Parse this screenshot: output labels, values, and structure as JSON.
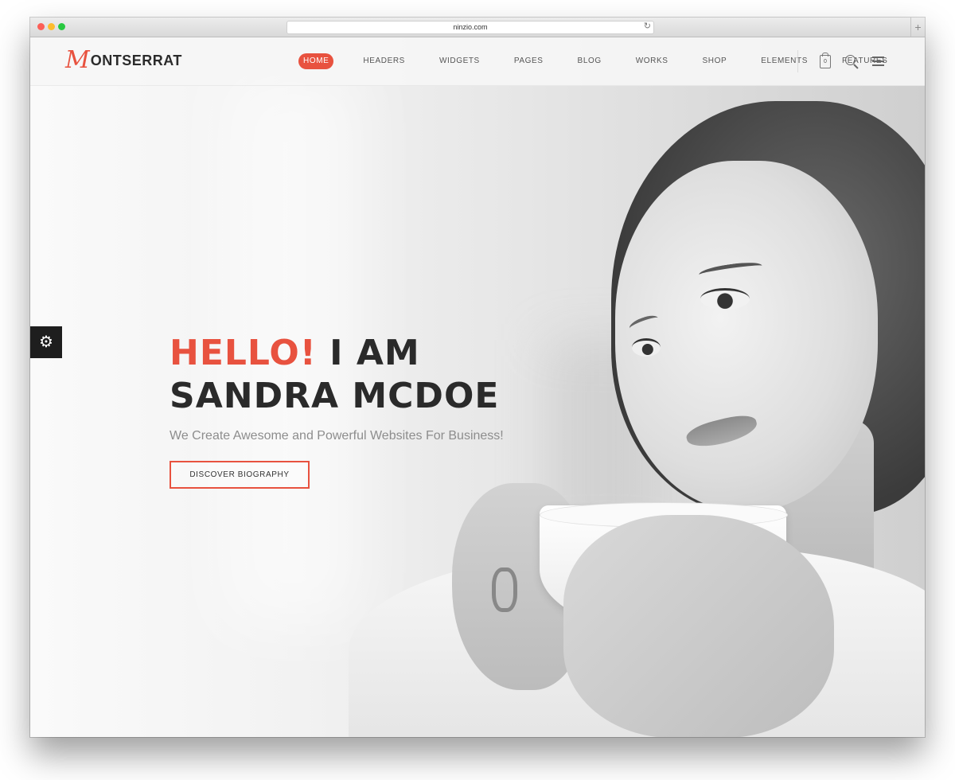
{
  "browser": {
    "url": "ninzio.com",
    "reload_glyph": "↻",
    "new_tab_glyph": "+"
  },
  "logo": {
    "mark": "M",
    "text": "ONTSERRAT",
    "brand_color": "#e8523f"
  },
  "nav": {
    "items": [
      {
        "label": "HOME",
        "active": true
      },
      {
        "label": "HEADERS",
        "active": false
      },
      {
        "label": "WIDGETS",
        "active": false
      },
      {
        "label": "PAGES",
        "active": false
      },
      {
        "label": "BLOG",
        "active": false
      },
      {
        "label": "WORKS",
        "active": false
      },
      {
        "label": "SHOP",
        "active": false
      },
      {
        "label": "ELEMENTS",
        "active": false
      },
      {
        "label": "FEATURES",
        "active": false
      }
    ],
    "cart_count": "0",
    "icons": [
      "cart-icon",
      "search-icon",
      "hamburger-menu-icon"
    ]
  },
  "settings": {
    "glyph": "⚙",
    "icon": "gear-icon"
  },
  "hero": {
    "greeting": "HELLO!",
    "line1_rest": " I AM",
    "line2": "SANDRA MCDOE",
    "tagline": "We Create Awesome and Powerful Websites For Business!",
    "cta_label": "DISCOVER BIOGRAPHY"
  },
  "colors": {
    "accent": "#e8523f",
    "heading": "#2a2a2a",
    "muted": "#8d8d8d"
  }
}
